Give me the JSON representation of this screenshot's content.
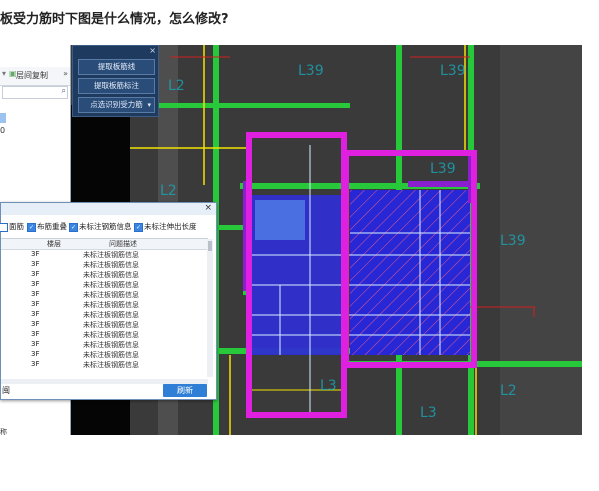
{
  "question": {
    "title": "板受力筋时下图是什么情况，怎么修改?"
  },
  "tree_panel": {
    "toolbar_label": "层间复制",
    "item_d0": "0"
  },
  "tool_panel": {
    "close_glyph": "×",
    "buttons": [
      "提取板筋线",
      "提取板筋标注",
      "点选识别受力筋"
    ]
  },
  "dialog": {
    "close_glyph": "×",
    "checks": [
      {
        "label": "面筋",
        "checked": false
      },
      {
        "label": "布筋重叠",
        "checked": true
      },
      {
        "label": "未标注钢筋信息",
        "checked": true
      },
      {
        "label": "未标注伸出长度",
        "checked": true
      }
    ],
    "columns": [
      "楼层",
      "问题描述"
    ],
    "rows": [
      {
        "floor": "3F",
        "desc": "未标注板钢筋信息"
      },
      {
        "floor": "3F",
        "desc": "未标注板钢筋信息"
      },
      {
        "floor": "3F",
        "desc": "未标注板钢筋信息"
      },
      {
        "floor": "3F",
        "desc": "未标注板钢筋信息"
      },
      {
        "floor": "3F",
        "desc": "未标注板钢筋信息"
      },
      {
        "floor": "3F",
        "desc": "未标注板钢筋信息"
      },
      {
        "floor": "3F",
        "desc": "未标注板钢筋信息"
      },
      {
        "floor": "3F",
        "desc": "未标注板钢筋信息"
      },
      {
        "floor": "3F",
        "desc": "未标注板钢筋信息"
      },
      {
        "floor": "3F",
        "desc": "未标注板钢筋信息"
      },
      {
        "floor": "3F",
        "desc": "未标注板钢筋信息"
      },
      {
        "floor": "3F",
        "desc": "未标注板钢筋信息"
      }
    ],
    "bottom_text": "闽",
    "refresh_label": "刷新"
  },
  "bottom_strip": {
    "text": "称"
  },
  "colors": {
    "canvas": "#3a3a3a",
    "beam": "#27c93a",
    "wall": "#4a4a4a",
    "yellow_line": "#f2e300",
    "magenta": "#e020e0",
    "slab_fill": "#3030d8",
    "hatch": "#e35a8c",
    "cyan_text": "#1aa6b8",
    "accent_blue": "#2f7fd6"
  }
}
